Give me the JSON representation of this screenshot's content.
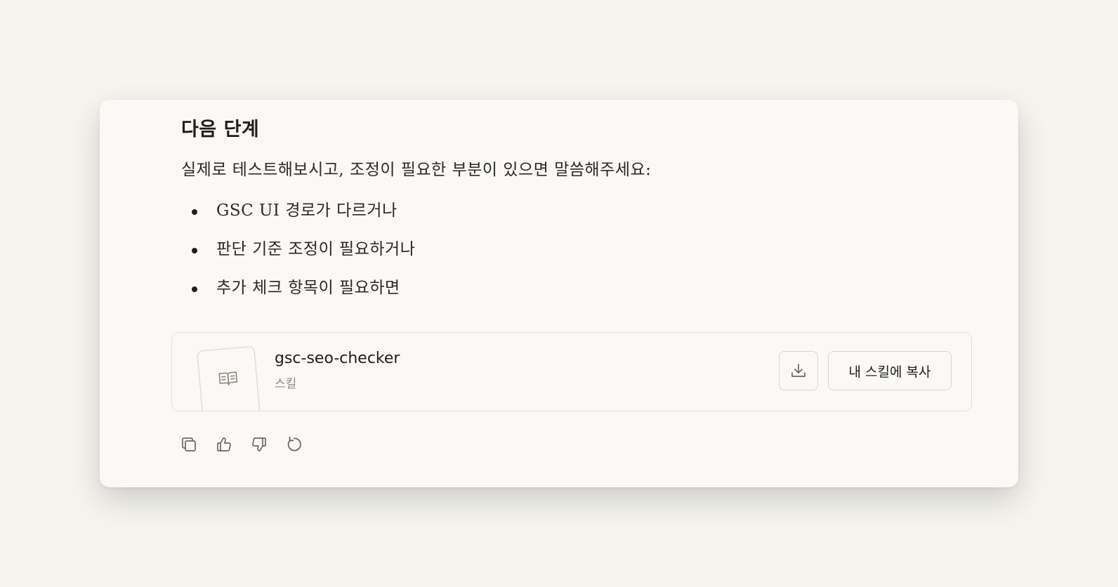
{
  "message": {
    "heading": "다음 단계",
    "intro": "실제로 테스트해보시고, 조정이 필요한 부분이 있으면 말씀해주세요:",
    "bullets": [
      "GSC UI 경로가 다르거나",
      "판단 기준 조정이 필요하거나",
      "추가 체크 항목이 필요하면"
    ]
  },
  "skill_card": {
    "name": "gsc-seo-checker",
    "type": "스킬",
    "thumbnail_icon": "book-icon",
    "download_icon": "download-icon",
    "copy_button_label": "내 스킬에 복사"
  },
  "actions": {
    "icons": [
      "copy-icon",
      "thumbs-up-icon",
      "thumbs-down-icon",
      "retry-icon"
    ]
  },
  "colors": {
    "background": "#f5f4ef",
    "card": "#faf9f5",
    "text": "#1f1e1b",
    "muted": "#8a8880",
    "border": "#d7d5cc"
  }
}
